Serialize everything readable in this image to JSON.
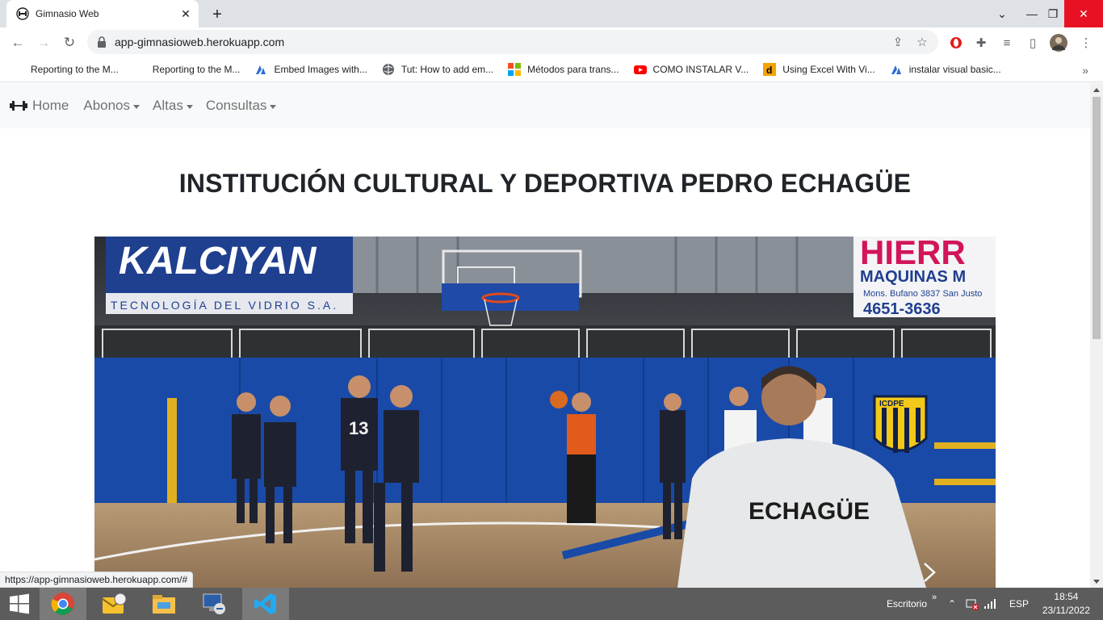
{
  "browser": {
    "tab_title": "Gimnasio Web",
    "url": "app-gimnasioweb.herokuapp.com",
    "bookmarks": [
      {
        "label": "Reporting to the M...",
        "icon": "blank-page-icon"
      },
      {
        "label": "Reporting to the M...",
        "icon": "blank-page-icon"
      },
      {
        "label": "Embed Images with...",
        "icon": "azure-icon"
      },
      {
        "label": "Tut: How to add em...",
        "icon": "globe-icon"
      },
      {
        "label": "Métodos para trans...",
        "icon": "microsoft-icon"
      },
      {
        "label": "COMO INSTALAR V...",
        "icon": "youtube-icon"
      },
      {
        "label": "Using Excel With Vi...",
        "icon": "dev-icon"
      },
      {
        "label": "instalar visual basic...",
        "icon": "azure-icon"
      }
    ],
    "status_url": "https://app-gimnasioweb.herokuapp.com/#"
  },
  "page": {
    "nav": {
      "home": "Home",
      "abonos": "Abonos",
      "altas": "Altas",
      "consultas": "Consultas"
    },
    "heading": "INSTITUCIÓN CULTURAL Y DEPORTIVA PEDRO ECHAGÜE",
    "carousel": {
      "banner_left": "KALCIYAN",
      "banner_left_sub": "TECNOLOGÍA DEL VIDRIO S.A.",
      "banner_right": "HIERR",
      "banner_right_sub": "MAQUINAS M",
      "banner_right_addr": "Mons. Bufano 3837 San Justo",
      "banner_right_phone": "4651-3636",
      "shirt_text": "ECHAGÜE",
      "crest": "ICDPE",
      "player_number": "13"
    }
  },
  "taskbar": {
    "desktop_label": "Escritorio",
    "lang": "ESP",
    "time": "18:54",
    "date": "23/11/2022"
  },
  "colors": {
    "wall_blue": "#1a4aa8",
    "navbar_bg": "#f8f9fa",
    "taskbar_bg": "#5c5c5c"
  }
}
